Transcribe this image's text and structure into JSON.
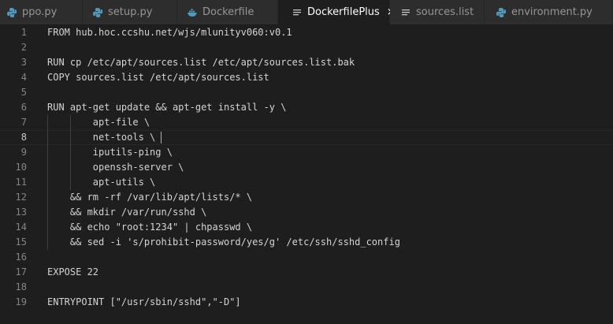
{
  "colors": {
    "tab_bar_bg": "#252526",
    "tab_inactive_bg": "#2d2d2d",
    "tab_active_bg": "#1e1e1e",
    "editor_bg": "#1e1e1e",
    "text": "#d4d4d4",
    "line_number": "#858585",
    "python_icon": "#519aba",
    "list_icon": "#c5c5c5"
  },
  "tabs": [
    {
      "label": "ppo.py",
      "icon": "python-icon",
      "active": false
    },
    {
      "label": "setup.py",
      "icon": "python-icon",
      "active": false
    },
    {
      "label": "Dockerfile",
      "icon": "docker-icon",
      "active": false
    },
    {
      "label": "DockerfilePlus",
      "icon": "list-icon",
      "active": true,
      "close": "×"
    },
    {
      "label": "sources.list",
      "icon": "list-icon",
      "active": false
    },
    {
      "label": "environment.py",
      "icon": "python-icon",
      "active": false
    }
  ],
  "editor": {
    "current_line": 8,
    "lines": [
      {
        "n": "1",
        "text": "FROM hub.hoc.ccshu.net/wjs/mlunityv060:v0.1"
      },
      {
        "n": "2",
        "text": ""
      },
      {
        "n": "3",
        "text": "RUN cp /etc/apt/sources.list /etc/apt/sources.list.bak"
      },
      {
        "n": "4",
        "text": "COPY sources.list /etc/apt/sources.list"
      },
      {
        "n": "5",
        "text": ""
      },
      {
        "n": "6",
        "text": "RUN apt-get update && apt-get install -y \\"
      },
      {
        "n": "7",
        "text": "        apt-file \\"
      },
      {
        "n": "8",
        "text": "        net-tools \\"
      },
      {
        "n": "9",
        "text": "        iputils-ping \\"
      },
      {
        "n": "10",
        "text": "        openssh-server \\"
      },
      {
        "n": "11",
        "text": "        apt-utils \\"
      },
      {
        "n": "12",
        "text": "    && rm -rf /var/lib/apt/lists/* \\"
      },
      {
        "n": "13",
        "text": "    && mkdir /var/run/sshd \\"
      },
      {
        "n": "14",
        "text": "    && echo \"root:1234\" | chpasswd \\"
      },
      {
        "n": "15",
        "text": "    && sed -i 's/prohibit-password/yes/g' /etc/ssh/sshd_config"
      },
      {
        "n": "16",
        "text": ""
      },
      {
        "n": "17",
        "text": "EXPOSE 22"
      },
      {
        "n": "18",
        "text": ""
      },
      {
        "n": "19",
        "text": "ENTRYPOINT [\"/usr/sbin/sshd\",\"-D\"]"
      }
    ]
  }
}
